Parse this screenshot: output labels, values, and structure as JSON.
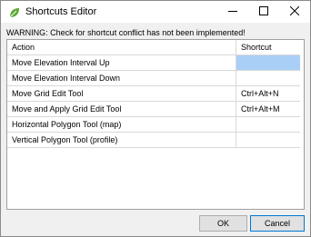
{
  "window": {
    "title": "Shortcuts Editor",
    "app_icon": "leaf-icon",
    "controls": {
      "minimize": "minimize-icon",
      "maximize": "maximize-icon",
      "close": "close-icon"
    }
  },
  "warning": "WARNING: Check for shortcut conflict has not been implemented!",
  "table": {
    "columns": [
      "Action",
      "Shortcut"
    ],
    "rows": [
      {
        "action": "Move Elevation Interval Up",
        "shortcut": "",
        "selected": true
      },
      {
        "action": "Move Elevation Interval Down",
        "shortcut": ""
      },
      {
        "action": "Move Grid Edit Tool",
        "shortcut": "Ctrl+Alt+N"
      },
      {
        "action": "Move and Apply Grid Edit Tool",
        "shortcut": "Ctrl+Alt+M"
      },
      {
        "action": "Horizontal Polygon Tool (map)",
        "shortcut": ""
      },
      {
        "action": "Vertical Polygon Tool (profile)",
        "shortcut": ""
      }
    ]
  },
  "buttons": {
    "ok": "OK",
    "cancel": "Cancel"
  },
  "colors": {
    "selection": "#a9cff7",
    "default_button_border": "#0078d7",
    "icon_green": "#5aa832"
  }
}
